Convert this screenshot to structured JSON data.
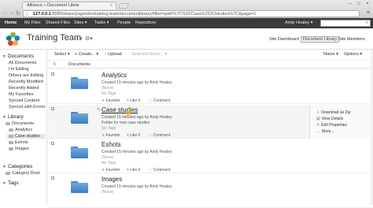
{
  "browser": {
    "tab_title": "Alfresco » Document Librar",
    "url_host": "127.0.0.1",
    "url_rest": ":8080/share/page/site/training-team/documentlibrary#filter=path%7C%2FCase%252Ostudies%7C&page=1"
  },
  "appbar": {
    "items": [
      "Home",
      "My Files",
      "Shared Files",
      "Sites ▾",
      "Tasks ▾",
      "People",
      "Repository"
    ],
    "user": "Andy Healey ▾"
  },
  "site": {
    "title": "Training Team",
    "links": [
      "Site Dashboard",
      "Document Library",
      "Site Members"
    ]
  },
  "toolbar": {
    "select": "Select ▾",
    "create": "+ Create... ▾",
    "upload": "↑ Upload",
    "selected": "Selected Items... ▾",
    "name_sort": "Name ▾",
    "options": "Options ▾"
  },
  "columns": {
    "documents": "Documents"
  },
  "sidebar": {
    "documents_header": "Documents",
    "document_filters": [
      "All Documents",
      "I'm Editing",
      "Others are Editing",
      "Recently Modified",
      "Recently Added",
      "My Favorites",
      "Synced Content",
      "Synced with Errors"
    ],
    "library_header": "Library",
    "library_root": "Documents",
    "library_folders": [
      "Analytics",
      "Case studies",
      "Eshots",
      "Images"
    ],
    "categories_header": "Categories",
    "category_root": "Category Root",
    "tags_header": "Tags"
  },
  "rows": [
    {
      "name": "Analytics",
      "created": "Created 15 minutes ago by Andy Healey",
      "desc": "(None)",
      "tags": "No Tags",
      "favorite": "Favorite",
      "like": "Like",
      "like_count": "0",
      "comment": "Comment"
    },
    {
      "name": "Case studies",
      "created": "Created 15 minutes ago by Andy Healey",
      "desc": "Folder for new case studies",
      "tags": "No Tags",
      "favorite": "Favorite",
      "like": "Like",
      "like_count": "0",
      "comment": "Comment"
    },
    {
      "name": "Eshots",
      "created": "Created 15 minutes ago by Andy Healey",
      "desc": "(None)",
      "tags": "No Tags",
      "favorite": "Favorite",
      "like": "Like",
      "like_count": "0",
      "comment": "Comment"
    },
    {
      "name": "Images",
      "created": "Created 15 minutes ago by Andy Healey",
      "desc": "(None)",
      "tags": "",
      "favorite": "",
      "like": "",
      "like_count": "",
      "comment": ""
    }
  ],
  "row_actions": [
    "Download as Zip",
    "View Details",
    "Edit Properties",
    "More..."
  ],
  "icons": {
    "folder": "folder-icon",
    "star": "star-icon",
    "thumb": "like-icon",
    "comment": "comment-icon"
  },
  "colors": {
    "folder": "#4a8ac9",
    "appbar": "#3b3b3b",
    "highlight_row": "#f5f5f5"
  }
}
